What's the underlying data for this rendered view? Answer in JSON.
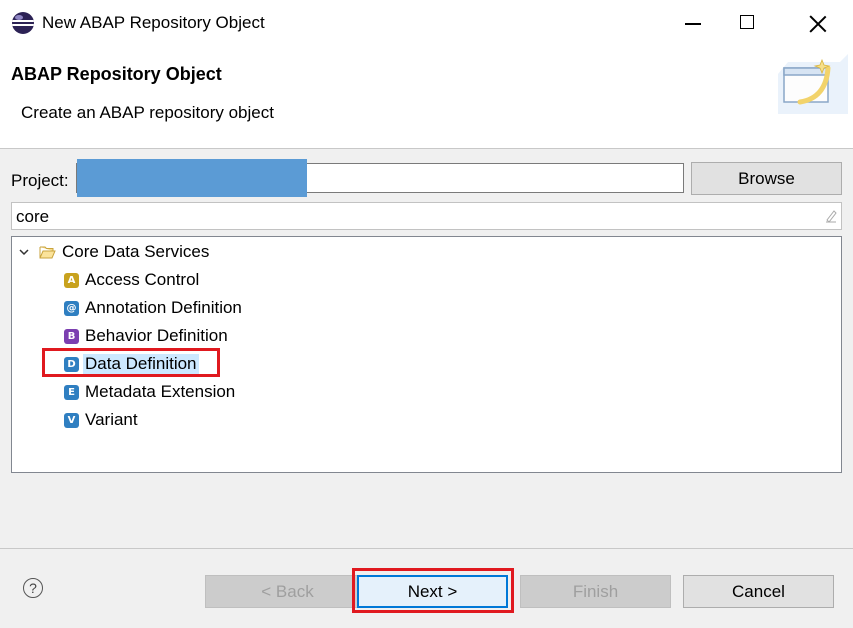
{
  "window": {
    "title": "New ABAP Repository Object"
  },
  "header": {
    "title": "ABAP Repository Object",
    "description": "Create an ABAP repository object"
  },
  "project": {
    "label": "Project:",
    "value": "",
    "browse_label": "Browse"
  },
  "filter": {
    "value": "core"
  },
  "tree": {
    "root": {
      "label": "Core Data Services",
      "expanded": true,
      "icon": "folder-open-icon"
    },
    "items": [
      {
        "label": "Access Control",
        "icon": "access-control-icon",
        "glyph": "A",
        "color": "#c8a21e"
      },
      {
        "label": "Annotation Definition",
        "icon": "annotation-definition-icon",
        "glyph": "@",
        "color": "#2f7fc1"
      },
      {
        "label": "Behavior Definition",
        "icon": "behavior-definition-icon",
        "glyph": "B",
        "color": "#7b3fb0"
      },
      {
        "label": "Data Definition",
        "icon": "data-definition-icon",
        "glyph": "D",
        "color": "#2f7fc1",
        "selected": true
      },
      {
        "label": "Metadata Extension",
        "icon": "metadata-extension-icon",
        "glyph": "E",
        "color": "#2f7fc1"
      },
      {
        "label": "Variant",
        "icon": "variant-icon",
        "glyph": "V",
        "color": "#2f7fc1"
      }
    ]
  },
  "footer": {
    "back_label": "< Back",
    "next_label": "Next >",
    "finish_label": "Finish",
    "cancel_label": "Cancel"
  },
  "colors": {
    "highlight": "#e0191f",
    "selection": "#cce8ff",
    "accent": "#0078d7"
  }
}
